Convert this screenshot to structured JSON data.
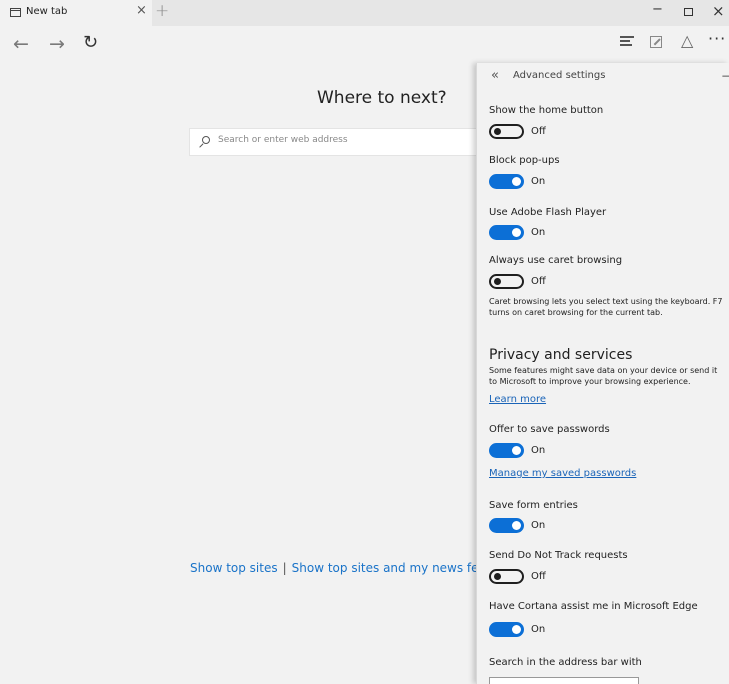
{
  "browser": {
    "tab_title": "New tab",
    "tab_close": "×",
    "new_tab": "+",
    "window_controls": {
      "minimize": "−",
      "close": "×"
    }
  },
  "nav": {
    "back_icon": "back-arrow-icon",
    "forward_icon": "forward-arrow-icon",
    "refresh_icon": "refresh-icon",
    "more": "···"
  },
  "main": {
    "heading": "Where to next?",
    "search_placeholder": "Search or enter web address",
    "top_sites_link": "Show top sites",
    "separator": "|",
    "top_sites_news_link": "Show top sites and my news feed"
  },
  "panel": {
    "back_glyph": "«",
    "title": "Advanced settings",
    "settings": [
      {
        "label": "Show the home button",
        "state": "Off"
      },
      {
        "label": "Block pop-ups",
        "state": "On"
      },
      {
        "label": "Use Adobe Flash Player",
        "state": "On"
      },
      {
        "label": "Always use caret browsing",
        "state": "Off"
      }
    ],
    "caret_note": "Caret browsing lets you select text using the keyboard. F7 turns on caret browsing for the current tab.",
    "privacy": {
      "heading": "Privacy and services",
      "note": "Some features might save data on your device or send it to Microsoft to improve your browsing experience.",
      "learn_more": "Learn more"
    },
    "privacy_settings": [
      {
        "label": "Offer to save passwords",
        "state": "On"
      },
      {
        "label": "Save form entries",
        "state": "On"
      },
      {
        "label": "Send Do Not Track requests",
        "state": "Off"
      },
      {
        "label": "Have Cortana assist me in Microsoft Edge",
        "state": "On"
      }
    ],
    "manage_passwords": "Manage my saved passwords",
    "search_bar_label": "Search in the address bar with"
  },
  "colors": {
    "accent": "#0c6fd6",
    "link": "#1a64b8",
    "highlight": "#d64848"
  }
}
